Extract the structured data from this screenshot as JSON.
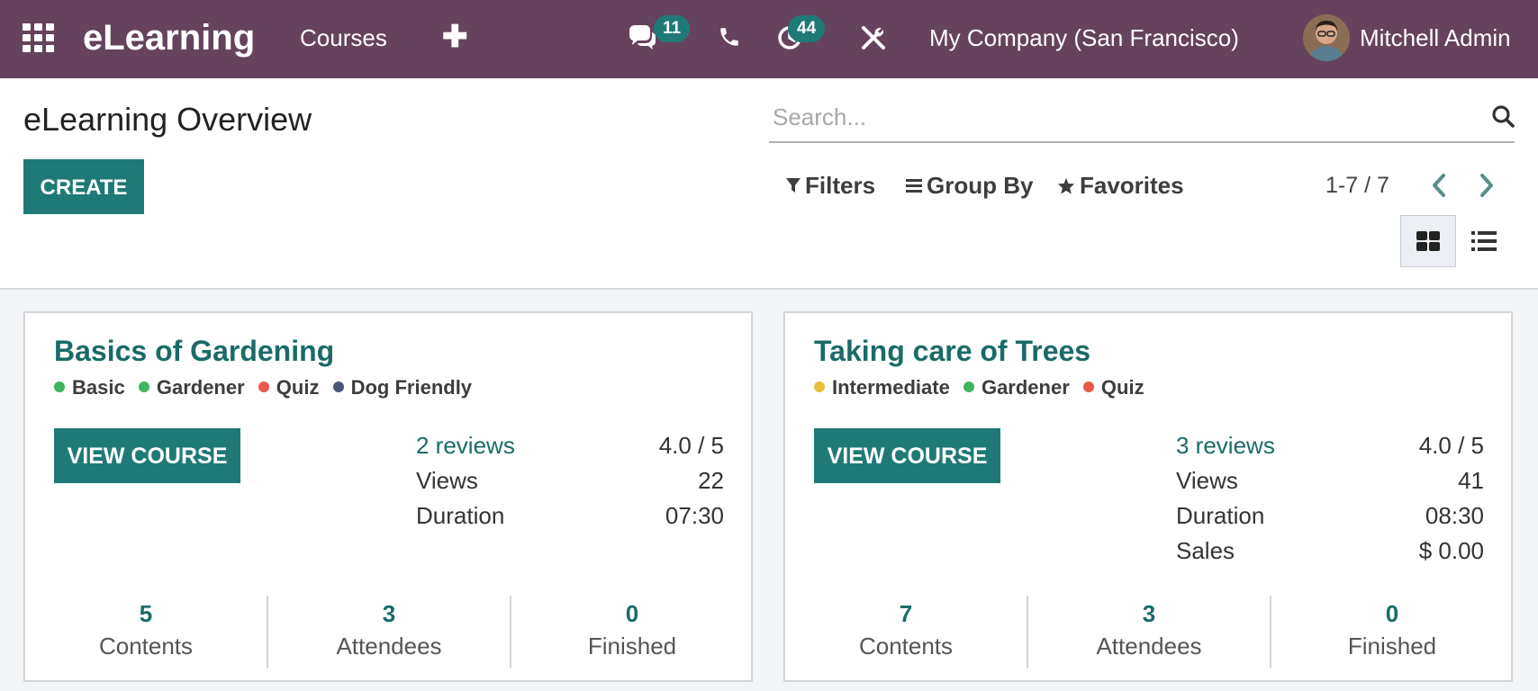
{
  "navbar": {
    "brand": "eLearning",
    "menu_courses": "Courses",
    "plus": "✚",
    "messages_badge": "11",
    "activities_badge": "44",
    "company": "My Company (San Francisco)",
    "user": "Mitchell Admin",
    "bg_color": "#65435c"
  },
  "control": {
    "title": "eLearning Overview",
    "create_label": "CREATE",
    "search_placeholder": "Search...",
    "filters_label": "Filters",
    "groupby_label": "Group By",
    "favorites_label": "Favorites",
    "pager": "1-7 / 7"
  },
  "courses": [
    {
      "title": "Basics of Gardening",
      "tags": [
        {
          "label": "Basic",
          "color": "#3fb55f"
        },
        {
          "label": "Gardener",
          "color": "#3fb55f"
        },
        {
          "label": "Quiz",
          "color": "#e8594a"
        },
        {
          "label": "Dog Friendly",
          "color": "#4a5578"
        }
      ],
      "button_label": "VIEW COURSE",
      "reviews_label": "2 reviews",
      "rating": "4.0 / 5",
      "stats": [
        {
          "label": "Views",
          "value": "22"
        },
        {
          "label": "Duration",
          "value": "07:30"
        }
      ],
      "footer": [
        {
          "num": "5",
          "label": "Contents"
        },
        {
          "num": "3",
          "label": "Attendees"
        },
        {
          "num": "0",
          "label": "Finished"
        }
      ]
    },
    {
      "title": "Taking care of Trees",
      "tags": [
        {
          "label": "Intermediate",
          "color": "#e8c13a"
        },
        {
          "label": "Gardener",
          "color": "#3fb55f"
        },
        {
          "label": "Quiz",
          "color": "#e8594a"
        }
      ],
      "button_label": "VIEW COURSE",
      "reviews_label": "3 reviews",
      "rating": "4.0 / 5",
      "stats": [
        {
          "label": "Views",
          "value": "41"
        },
        {
          "label": "Duration",
          "value": "08:30"
        },
        {
          "label": "Sales",
          "value": "$ 0.00"
        }
      ],
      "footer": [
        {
          "num": "7",
          "label": "Contents"
        },
        {
          "num": "3",
          "label": "Attendees"
        },
        {
          "num": "0",
          "label": "Finished"
        }
      ]
    }
  ]
}
